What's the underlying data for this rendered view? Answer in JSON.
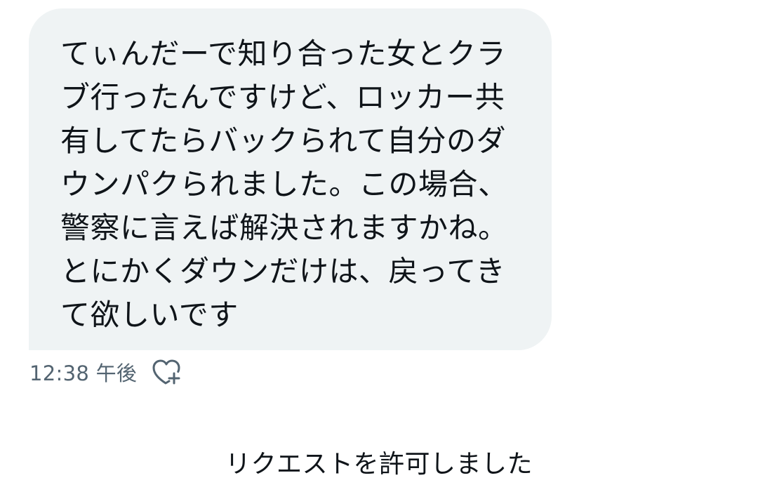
{
  "message": {
    "text": "てぃんだーで知り合った女とクラ\nブ行ったんですけど、ロッカー共\n有してたらバックられて自分のダ\nウンパクられました。この場合、\n警察に言えば解決されますかね。\nとにかくダウンだけは、戻ってき\nて欲しいです",
    "timestamp": "12:38 午後",
    "bubble_color": "#eff3f4",
    "react_icon": "heart-plus-icon"
  },
  "system_message": {
    "text": "リクエストを許可しました"
  }
}
